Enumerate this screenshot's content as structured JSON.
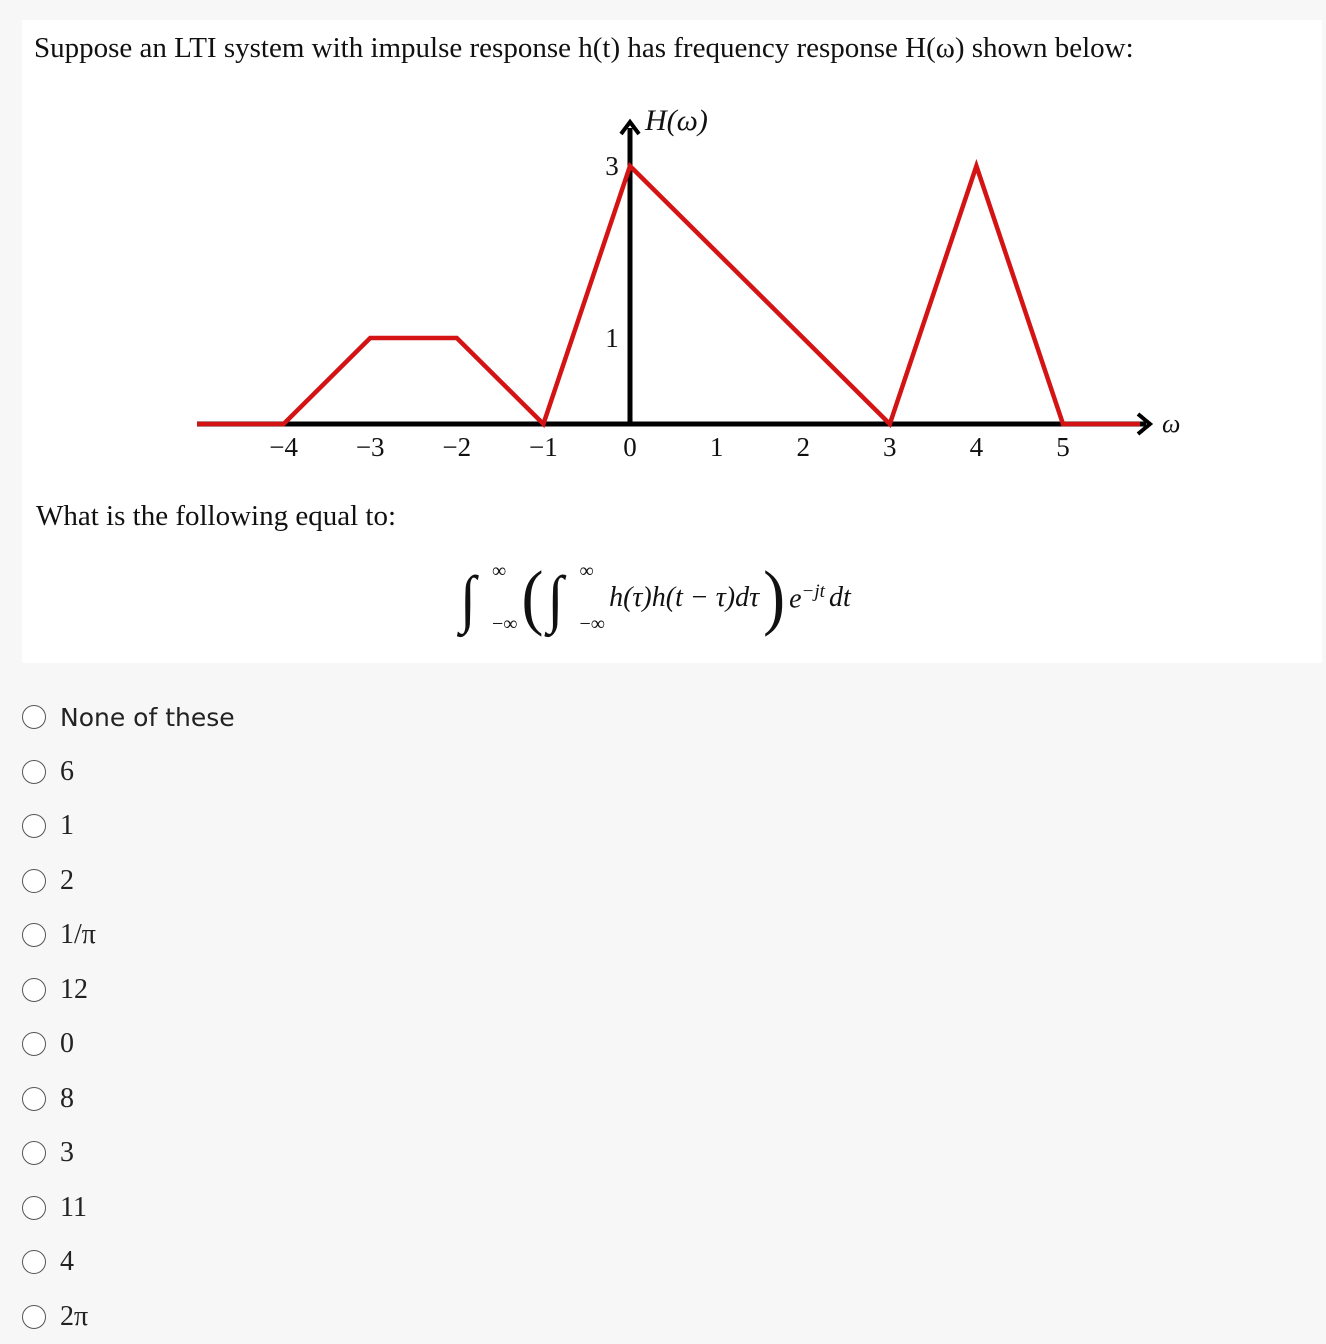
{
  "question": {
    "intro": "Suppose an LTI system with impulse response h(t) has frequency response H(ω) shown below:",
    "prompt": "What is the following equal to:",
    "formula": {
      "outer_integral": "∫",
      "upper": "∞",
      "lower": "−∞",
      "inner_integral": "∫",
      "integrand": "h(τ)h(t − τ)dτ",
      "open_paren": "(",
      "close_paren": ")",
      "exp_base": "e",
      "exp_power": "−jt",
      "differential": "dt"
    }
  },
  "chart_data": {
    "type": "line",
    "ylabel": "H(ω)",
    "xlabel": "ω",
    "x": [
      -5,
      -4,
      -3,
      -2,
      -1,
      0,
      3,
      4,
      5,
      6
    ],
    "y": [
      0,
      0,
      1,
      1,
      0,
      3,
      0,
      3,
      0,
      0
    ],
    "x_ticks": [
      "−4",
      "−3",
      "−2",
      "−1",
      "0",
      "1",
      "2",
      "3",
      "4",
      "5"
    ],
    "x_tick_values": [
      -4,
      -3,
      -2,
      -1,
      0,
      1,
      2,
      3,
      4,
      5
    ],
    "y_ticks": [
      "1",
      "3"
    ],
    "y_tick_values": [
      1,
      3
    ],
    "line_color": "#d41414",
    "axis_color": "#000000",
    "grid": false
  },
  "options": [
    {
      "label": "None of these",
      "sans": true
    },
    {
      "label": "6"
    },
    {
      "label": "1"
    },
    {
      "label": "2"
    },
    {
      "label": "1/π"
    },
    {
      "label": "12"
    },
    {
      "label": "0"
    },
    {
      "label": "8"
    },
    {
      "label": "3"
    },
    {
      "label": "11"
    },
    {
      "label": "4"
    },
    {
      "label": "2π"
    }
  ]
}
